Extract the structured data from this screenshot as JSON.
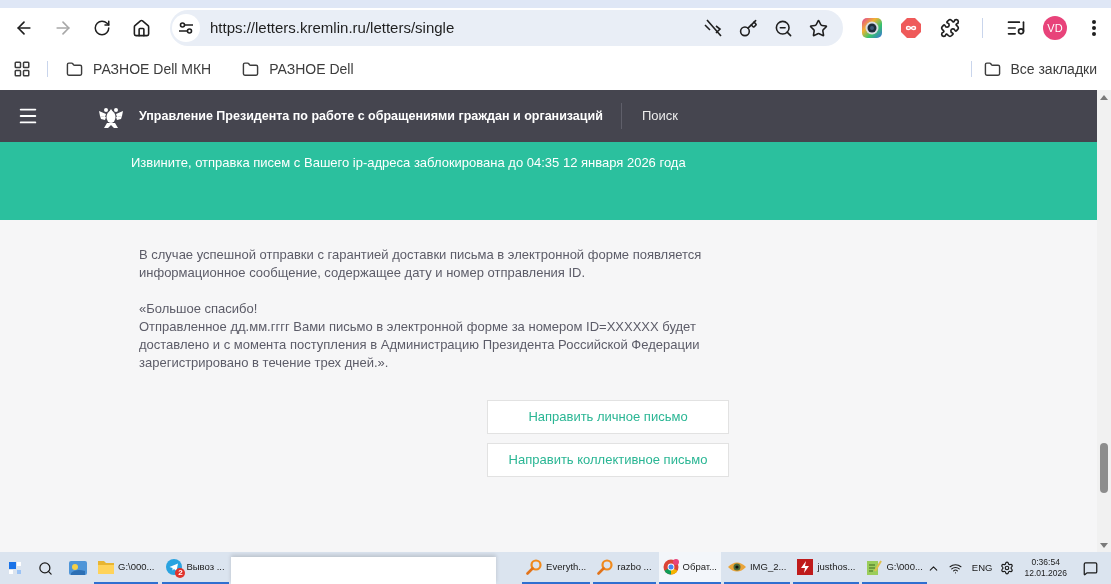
{
  "browser": {
    "forward_button": {
      "disabled": true
    },
    "url": "https://letters.kremlin.ru/letters/single",
    "profile_initials": "VD"
  },
  "bookmarks": {
    "items": [
      {
        "label": "РАЗНОЕ Dell МКН"
      },
      {
        "label": "РАЗНОЕ Dell"
      }
    ],
    "all_bookmarks": "Все закладки"
  },
  "site_header": {
    "title": "Управление Президента по работе с обращениями граждан и организаций",
    "search_link": "Поиск"
  },
  "alert": {
    "message": "Извините, отправка писем с Вашего ip-адреса заблокирована до 04:35 12 января 2026 года"
  },
  "content": {
    "paragraphs": [
      {
        "lines": [
          "В случае успешной отправки с гарантией доставки письма в электронной форме появляется информационное сообщение, содержащее дату и номер отправления ID."
        ]
      },
      {
        "lines": [
          "«Большое спасибо!",
          "Отправленное дд.мм.гггг Вами письмо в электронной форме за номером ID=XXXXXX будет доставлено и с момента поступления в Администрацию Президента Российской Федерации зарегистрировано в течение трех дней.»."
        ]
      }
    ],
    "buttons": [
      "Направить личное письмо",
      "Направить коллективное письмо"
    ]
  },
  "taskbar": {
    "left_items": [
      {
        "kind": "folder",
        "label": "G:\\000...",
        "selected": false
      },
      {
        "kind": "messenger",
        "label": "Вывоз ...",
        "badge": "2",
        "selected": false
      }
    ],
    "right_items": [
      {
        "kind": "search-tool",
        "label": "Everyth...",
        "selected": false
      },
      {
        "kind": "search-tool",
        "label": "razbo ...",
        "selected": false
      },
      {
        "kind": "browser",
        "label": "Обрат...",
        "selected": true
      },
      {
        "kind": "viewer",
        "label": "IMG_2...",
        "selected": false
      },
      {
        "kind": "ftp",
        "label": "justhos...",
        "selected": false
      },
      {
        "kind": "editor",
        "label": "G:\\000...",
        "selected": false
      }
    ],
    "language": "ENG",
    "time": "0:36:54",
    "date": "12.01.2026"
  }
}
